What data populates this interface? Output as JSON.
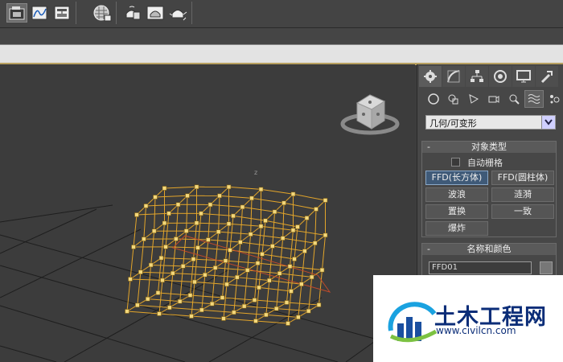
{
  "toolbar": {
    "groups": [
      [
        "layers-manager-icon",
        "curve-editor-icon",
        "schematic-view-icon"
      ],
      [
        "material-editor-icon"
      ],
      [
        "render-setup-icon",
        "rendered-frame-icon",
        "render-teapot-icon"
      ]
    ]
  },
  "command_panel": {
    "tabs": [
      "create-icon",
      "modify-icon",
      "hierarchy-icon",
      "motion-icon",
      "display-icon",
      "utilities-icon"
    ],
    "subtabs": [
      "geometry-icon",
      "shapes-icon",
      "lights-icon",
      "cameras-icon",
      "helpers-icon",
      "space-warps-icon",
      "systems-icon"
    ],
    "category": "几何/可变形",
    "object_type": {
      "title": "对象类型",
      "autogrid_label": "自动栅格",
      "buttons": [
        "FFD(长方体)",
        "FFD(圆柱体)",
        "波浪",
        "涟漪",
        "置换",
        "一致",
        "爆炸"
      ]
    },
    "name_color": {
      "title": "名称和颜色",
      "name_value": "FFD01"
    },
    "rollout_sign": "-"
  },
  "viewport": {
    "axis_label": "z"
  },
  "watermark": {
    "title": "土木工程网",
    "url": "www.civilcn.com"
  },
  "colors": {
    "lattice": "#e3a52a",
    "control_point": "#f3d77a",
    "selection": "#3f5a78"
  }
}
